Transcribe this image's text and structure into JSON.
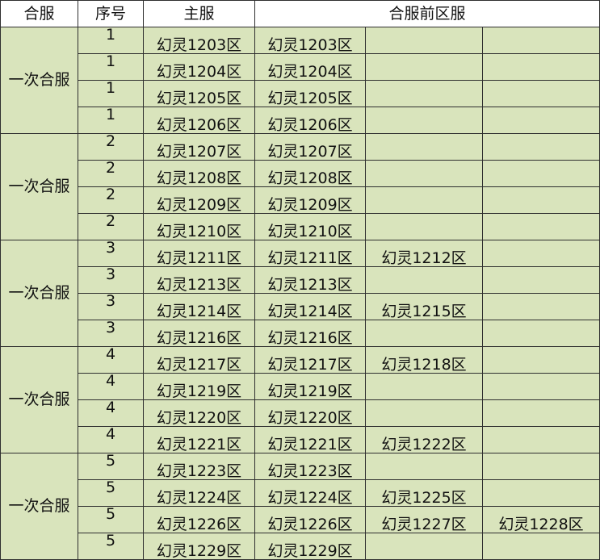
{
  "headers": {
    "merge": "合服",
    "seq": "序号",
    "main": "主服",
    "before": "合服前区服"
  },
  "groups": [
    {
      "label": "一次合服",
      "rows": [
        {
          "seq": "1",
          "main": "幻灵1203区",
          "servers": [
            "幻灵1203区",
            "",
            ""
          ]
        },
        {
          "seq": "1",
          "main": "幻灵1204区",
          "servers": [
            "幻灵1204区",
            "",
            ""
          ]
        },
        {
          "seq": "1",
          "main": "幻灵1205区",
          "servers": [
            "幻灵1205区",
            "",
            ""
          ]
        },
        {
          "seq": "1",
          "main": "幻灵1206区",
          "servers": [
            "幻灵1206区",
            "",
            ""
          ]
        }
      ]
    },
    {
      "label": "一次合服",
      "rows": [
        {
          "seq": "2",
          "main": "幻灵1207区",
          "servers": [
            "幻灵1207区",
            "",
            ""
          ]
        },
        {
          "seq": "2",
          "main": "幻灵1208区",
          "servers": [
            "幻灵1208区",
            "",
            ""
          ]
        },
        {
          "seq": "2",
          "main": "幻灵1209区",
          "servers": [
            "幻灵1209区",
            "",
            ""
          ]
        },
        {
          "seq": "2",
          "main": "幻灵1210区",
          "servers": [
            "幻灵1210区",
            "",
            ""
          ]
        }
      ]
    },
    {
      "label": "一次合服",
      "rows": [
        {
          "seq": "3",
          "main": "幻灵1211区",
          "servers": [
            "幻灵1211区",
            "幻灵1212区",
            ""
          ]
        },
        {
          "seq": "3",
          "main": "幻灵1213区",
          "servers": [
            "幻灵1213区",
            "",
            ""
          ]
        },
        {
          "seq": "3",
          "main": "幻灵1214区",
          "servers": [
            "幻灵1214区",
            "幻灵1215区",
            ""
          ]
        },
        {
          "seq": "3",
          "main": "幻灵1216区",
          "servers": [
            "幻灵1216区",
            "",
            ""
          ]
        }
      ]
    },
    {
      "label": "一次合服",
      "rows": [
        {
          "seq": "4",
          "main": "幻灵1217区",
          "servers": [
            "幻灵1217区",
            "幻灵1218区",
            ""
          ]
        },
        {
          "seq": "4",
          "main": "幻灵1219区",
          "servers": [
            "幻灵1219区",
            "",
            ""
          ]
        },
        {
          "seq": "4",
          "main": "幻灵1220区",
          "servers": [
            "幻灵1220区",
            "",
            ""
          ]
        },
        {
          "seq": "4",
          "main": "幻灵1221区",
          "servers": [
            "幻灵1221区",
            "幻灵1222区",
            ""
          ]
        }
      ]
    },
    {
      "label": "一次合服",
      "rows": [
        {
          "seq": "5",
          "main": "幻灵1223区",
          "servers": [
            "幻灵1223区",
            "",
            ""
          ]
        },
        {
          "seq": "5",
          "main": "幻灵1224区",
          "servers": [
            "幻灵1224区",
            "幻灵1225区",
            ""
          ]
        },
        {
          "seq": "5",
          "main": "幻灵1226区",
          "servers": [
            "幻灵1226区",
            "幻灵1227区",
            "幻灵1228区"
          ]
        },
        {
          "seq": "5",
          "main": "幻灵1229区",
          "servers": [
            "幻灵1229区",
            "",
            ""
          ]
        }
      ]
    }
  ]
}
